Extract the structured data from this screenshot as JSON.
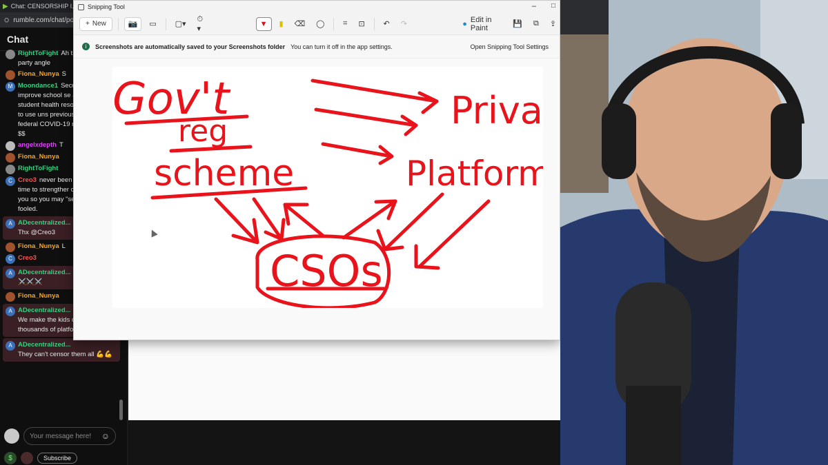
{
  "browser": {
    "tab_title": "Chat: CENSORSHIP I...",
    "url": "rumble.com/chat/pop"
  },
  "chat": {
    "title": "Chat",
    "messages": [
      {
        "user": "RightToFight",
        "text": "Ah t",
        "cont": "party angle",
        "color": "#35d07f",
        "avatar": "",
        "avatar_bg": "#888"
      },
      {
        "user": "Fiona_Nunya",
        "text": "S",
        "color": "#f5a623",
        "avatar": "",
        "avatar_bg": "#a0522d"
      },
      {
        "user": "Moondance1",
        "text": "Securing Our Scho",
        "cont": "improve school se access to student health resources - schools to use uns previously approp federal COVID-19 related funding $$",
        "color": "#35d07f",
        "avatar": "M",
        "avatar_bg": "#3b6fb6"
      },
      {
        "user": "angelxdepth",
        "text": "T",
        "color": "#e040fb",
        "avatar": "",
        "avatar_bg": "#bbb"
      },
      {
        "user": "Fiona_Nunya",
        "text": "",
        "color": "#f5a623",
        "avatar": "",
        "avatar_bg": "#a0522d"
      },
      {
        "user": "RightToFight",
        "text": "",
        "color": "#35d07f",
        "avatar": "",
        "avatar_bg": "#888"
      },
      {
        "user": "Creo3",
        "text": "never been",
        "cont": "time to strengther connection to you so you may \"see\" so easily fooled.",
        "color": "#ff5252",
        "avatar": "C",
        "avatar_bg": "#3b6fb6"
      },
      {
        "user": "ADecentralized...",
        "text": "",
        "cont": "Thx @Creo3",
        "color": "#35d07f",
        "avatar": "A",
        "avatar_bg": "#3b6fb6",
        "highlight": true
      },
      {
        "user": "Fiona_Nunya",
        "text": "L",
        "color": "#f5a623",
        "avatar": "",
        "avatar_bg": "#a0522d"
      },
      {
        "user": "Creo3",
        "text": "",
        "color": "#ff5252",
        "avatar": "C",
        "avatar_bg": "#3b6fb6"
      },
      {
        "user": "ADecentralized...",
        "text": "",
        "cont": "⚔️⚔️⚔️",
        "color": "#35d07f",
        "avatar": "A",
        "avatar_bg": "#3b6fb6",
        "highlight": true
      },
      {
        "user": "Fiona_Nunya",
        "text": "",
        "color": "#f5a623",
        "avatar": "",
        "avatar_bg": "#a0522d"
      },
      {
        "user": "ADecentralized...",
        "text": "",
        "cont": "We make the kids develop thousands of platforms",
        "color": "#35d07f",
        "avatar": "A",
        "avatar_bg": "#3b6fb6",
        "highlight": true
      },
      {
        "user": "ADecentralized...",
        "text": "",
        "cont": "They can't censor them all 💪💪",
        "color": "#35d07f",
        "avatar": "A",
        "avatar_bg": "#3b6fb6",
        "highlight": true
      }
    ],
    "input_placeholder": "Your message here!",
    "subscribe_label": "Subscribe"
  },
  "snipping_tool": {
    "title": "Snipping Tool",
    "new_label": "New",
    "edit_in_paint_label": "Edit in Paint",
    "info_bold": "Screenshots are automatically saved to your Screenshots folder",
    "info_text": "You can turn it off in the app settings.",
    "settings_link": "Open Snipping Tool Settings",
    "drawing": {
      "words": [
        "Gov't",
        "reg",
        "scheme",
        "Private",
        "Platforms",
        "CSOs"
      ],
      "ink_color": "#e8131b"
    }
  }
}
